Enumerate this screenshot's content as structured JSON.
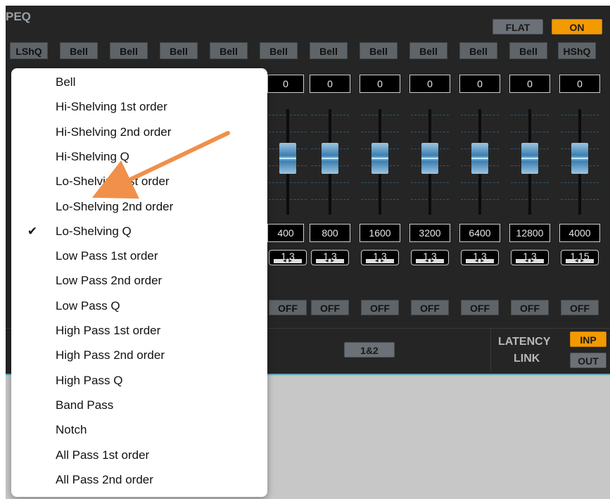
{
  "peq": {
    "title": "PEQ",
    "flat_label": "FLAT",
    "on_label": "ON"
  },
  "bands": {
    "types": [
      "LShQ",
      "Bell",
      "Bell",
      "Bell",
      "Bell",
      "Bell",
      "Bell",
      "Bell",
      "Bell",
      "Bell",
      "Bell",
      "HShQ"
    ],
    "gains": [
      "0",
      "0",
      "0",
      "0",
      "0",
      "0",
      "0"
    ],
    "freqs": [
      "400",
      "800",
      "1600",
      "3200",
      "6400",
      "12800",
      "4000"
    ],
    "qs": [
      "1.3",
      "1.3",
      "1.3",
      "1.3",
      "1.3",
      "1.3",
      "1.15"
    ],
    "offs": [
      "OFF",
      "OFF",
      "OFF",
      "OFF",
      "OFF",
      "OFF",
      "OFF"
    ]
  },
  "routing": {
    "pair_label": "1&2",
    "latency_label": "LATENCY",
    "link_label": "LINK",
    "inp_label": "INP",
    "out_label": "OUT"
  },
  "menu": {
    "items": [
      "Bell",
      "Hi-Shelving 1st order",
      "Hi-Shelving 2nd order",
      "Hi-Shelving Q",
      "Lo-Shelving 1st order",
      "Lo-Shelving 2nd order",
      "Lo-Shelving Q",
      "Low Pass 1st order",
      "Low Pass 2nd order",
      "Low Pass Q",
      "High Pass 1st order",
      "High Pass 2nd order",
      "High Pass Q",
      "Band Pass",
      "Notch",
      "All Pass 1st order",
      "All Pass 2nd order"
    ],
    "selected": "Lo-Shelving Q",
    "check_glyph": "✔"
  },
  "annotation": {
    "arrow_color": "#f0904a"
  },
  "colors": {
    "accent_orange": "#f29a00",
    "panel_bg": "#252525",
    "slider_blue": "#3e7fb1"
  }
}
